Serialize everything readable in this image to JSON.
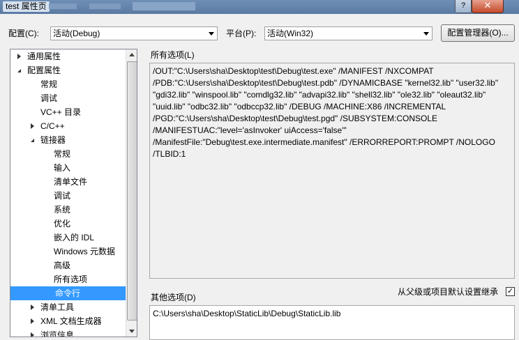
{
  "window": {
    "title": "test 属性页",
    "close_label": "✕",
    "help_label": "?"
  },
  "config": {
    "label": "配置(C):",
    "value": "活动(Debug)",
    "platform_label": "平台(P):",
    "platform_value": "活动(Win32)",
    "manager_button": "配置管理器(O)..."
  },
  "tree": {
    "items": [
      {
        "label": "通用属性",
        "state": "collapsed",
        "level": 0
      },
      {
        "label": "配置属性",
        "state": "expanded",
        "level": 0
      },
      {
        "label": "常规",
        "level": 1
      },
      {
        "label": "调试",
        "level": 1
      },
      {
        "label": "VC++ 目录",
        "level": 1
      },
      {
        "label": "C/C++",
        "state": "collapsed",
        "level": 1
      },
      {
        "label": "链接器",
        "state": "expanded",
        "level": 1
      },
      {
        "label": "常规",
        "level": 2
      },
      {
        "label": "输入",
        "level": 2
      },
      {
        "label": "清单文件",
        "level": 2
      },
      {
        "label": "调试",
        "level": 2
      },
      {
        "label": "系统",
        "level": 2
      },
      {
        "label": "优化",
        "level": 2
      },
      {
        "label": "嵌入的 IDL",
        "level": 2
      },
      {
        "label": "Windows 元数据",
        "level": 2
      },
      {
        "label": "高级",
        "level": 2
      },
      {
        "label": "所有选项",
        "level": 2
      },
      {
        "label": "命令行",
        "level": 2,
        "selected": true
      },
      {
        "label": "清单工具",
        "state": "collapsed",
        "level": 1
      },
      {
        "label": "XML 文档生成器",
        "state": "collapsed",
        "level": 1
      },
      {
        "label": "浏览信息",
        "state": "collapsed",
        "level": 1
      }
    ]
  },
  "all_options": {
    "label": "所有选项(L)",
    "text": "/OUT:\"C:\\Users\\sha\\Desktop\\test\\Debug\\test.exe\" /MANIFEST /NXCOMPAT /PDB:\"C:\\Users\\sha\\Desktop\\test\\Debug\\test.pdb\" /DYNAMICBASE \"kernel32.lib\" \"user32.lib\" \"gdi32.lib\" \"winspool.lib\" \"comdlg32.lib\" \"advapi32.lib\" \"shell32.lib\" \"ole32.lib\" \"oleaut32.lib\" \"uuid.lib\" \"odbc32.lib\" \"odbccp32.lib\" /DEBUG /MACHINE:X86 /INCREMENTAL /PGD:\"C:\\Users\\sha\\Desktop\\test\\Debug\\test.pgd\" /SUBSYSTEM:CONSOLE /MANIFESTUAC:\"level='asInvoker' uiAccess='false'\" /ManifestFile:\"Debug\\test.exe.intermediate.manifest\" /ERRORREPORT:PROMPT /NOLOGO /TLBID:1"
  },
  "other_options": {
    "label": "其他选项(D)",
    "inherit_label": "从父级或项目默认设置继承",
    "inherit_checked": true,
    "check_glyph": "✓",
    "value": "C:\\Users\\sha\\Desktop\\StaticLib\\Debug\\StaticLib.lib"
  }
}
